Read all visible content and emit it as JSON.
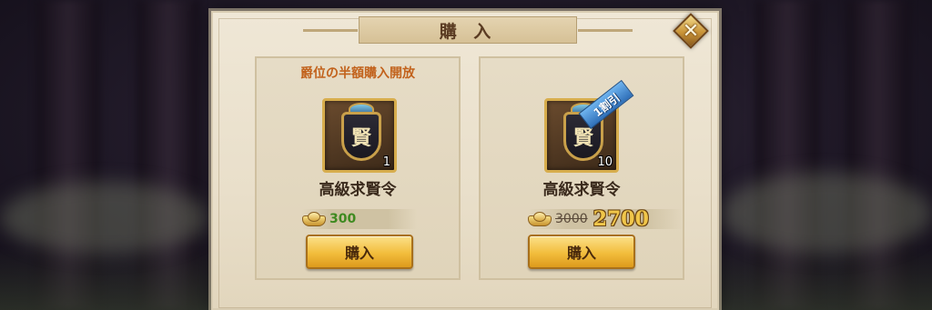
{
  "dialog": {
    "title": "購 入",
    "close_label": "✕"
  },
  "offers": [
    {
      "promo": "爵位の半額購入開放",
      "item_name": "高級求賢令",
      "item_glyph": "賢",
      "quantity": "1",
      "price": "300",
      "buy_label": "購入"
    },
    {
      "discount_badge": "1割引",
      "item_name": "高級求賢令",
      "item_glyph": "賢",
      "quantity": "10",
      "old_price": "3000",
      "price": "2700",
      "buy_label": "購入"
    }
  ],
  "colors": {
    "promo_text": "#c2621c",
    "price_green": "#3f8a20",
    "price_gold": "#f0c64a",
    "button_gold": "#f2bd3c"
  },
  "icons": {
    "close": "close-icon",
    "currency": "gold-ingot-icon",
    "item": "recruit-token-icon"
  }
}
